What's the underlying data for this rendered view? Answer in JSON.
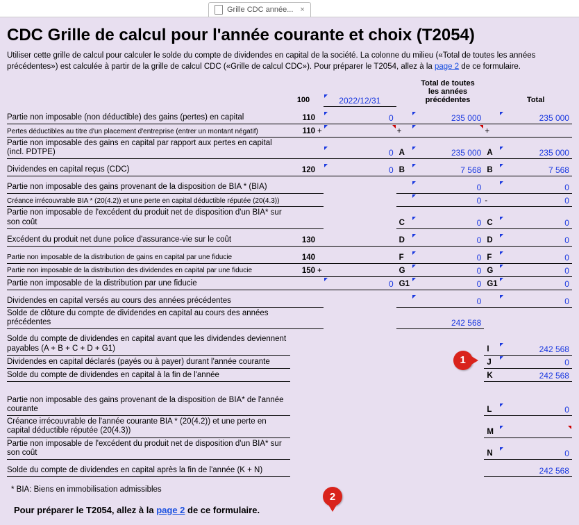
{
  "tab": {
    "label": "Grille CDC année..."
  },
  "title": "CDC Grille de calcul pour l'année courante et choix (T2054)",
  "intro_prefix": "Utiliser cette grille de calcul pour calculer le solde du compte de dividendes en capital de la société. La colonne du milieu («Total de toutes les années précédentes») est calculée à partir de la grille de calcul CDC («Grille de calcul CDC»). Pour préparer le T2054, allez à la ",
  "intro_link": "page 2",
  "intro_suffix": " de ce formulaire.",
  "col_header_100": "100",
  "date_value": "2022/12/31",
  "col_header_prev": "Total de toutes\nles années\nprécédentes",
  "col_header_total": "Total",
  "rows": {
    "r1": {
      "label": "Partie non imposable (non déductible) des gains (pertes) en capital",
      "line": "110",
      "cur": "0",
      "prev": "235 000",
      "tot": "235 000",
      "opcur": "",
      "opprev": "",
      "optot": ""
    },
    "r2": {
      "label": "Pertes déductibles au titre d'un placement d'entreprise (entrer un montant négatif)",
      "line": "110",
      "opcur": "+",
      "opprev": "+",
      "optot": "+"
    },
    "r3": {
      "label": "Partie non imposable des gains en capital par rapport aux pertes en capital (incl. PDTPE)",
      "cur": "0",
      "prev": "235 000",
      "tot": "235 000",
      "letA": "A"
    },
    "r4": {
      "label": "Dividendes en capital reçus (CDC)",
      "line": "120",
      "cur": "0",
      "prev": "7 568",
      "tot": "7 568",
      "letB": "B"
    },
    "r5": {
      "label": "Partie non imposable des gains provenant de la disposition de BIA * (BIA)",
      "prev": "0",
      "tot": "0"
    },
    "r6": {
      "label": "Créance irrécouvrable BIA * (20(4.2)) et une perte en capital déductible réputée (20(4.3))",
      "prev": "0",
      "tot": "0",
      "optot": "-"
    },
    "r7": {
      "label": "Partie non imposable de l'excédent du produit net de disposition d'un BIA* sur son coût",
      "prev": "0",
      "tot": "0",
      "letC": "C"
    },
    "r8": {
      "label": "Excédent du produit net dune police d'assurance-vie sur le coût",
      "line": "130",
      "prev": "0",
      "tot": "0",
      "letD": "D"
    },
    "r9": {
      "label": "Partie non imposable de la distribution de gains en capital par une fiducie",
      "line": "140",
      "prev": "0",
      "tot": "0",
      "letF": "F"
    },
    "r10": {
      "label": "Partie non imposable de la distribution des dividendes en capital par une fiducie",
      "line": "150",
      "opcur": "+",
      "opprev": "+",
      "optot": "+",
      "prev": "0",
      "tot": "0",
      "letG": "G"
    },
    "r11": {
      "label": "Partie non imposable de la distribution par une fiducie",
      "cur": "0",
      "prev": "0",
      "tot": "0",
      "letG1": "G1"
    },
    "r12": {
      "label": "Dividendes en capital versés au cours des années précédentes",
      "prev": "0",
      "tot": "0"
    },
    "r13": {
      "label": "Solde de clôture du compte de dividendes en capital au cours des années précédentes",
      "prev": "242 568"
    },
    "r14": {
      "label": "Solde du compte de dividendes en capital avant que les dividendes deviennent payables (A + B + C + D + G1)",
      "tot": "242 568",
      "letI": "I"
    },
    "r15": {
      "label": "Dividendes en capital déclarés (payés ou à payer) durant l'année courante",
      "tot": "0",
      "letJ": "J"
    },
    "r16": {
      "label": "Solde du compte de dividendes en capital à la fin de l'année",
      "tot": "242 568",
      "letK": "K"
    },
    "r17": {
      "label": "Partie non imposable des gains provenant de la disposition de BIA* de l'année courante",
      "tot": "0",
      "letL": "L"
    },
    "r18": {
      "label": "Créance irrécouvrable de l'année courante BIA * (20(4.2)) et une perte en capital déductible réputée (20(4.3))",
      "letM": "M",
      "optot": "-"
    },
    "r19": {
      "label": "Partie non imposable de l'excédent du produit net de disposition d'un BIA* sur son coût",
      "tot": "0",
      "letN": "N"
    },
    "r20": {
      "label": "Solde du compte de dividendes en capital après la fin de l'année (K + N)",
      "tot": "242 568"
    }
  },
  "footnote": "* BIA: Biens en immobilisation admissibles",
  "bottom_prefix": "Pour préparer le T2054, allez à la ",
  "bottom_link": "page 2",
  "bottom_suffix": " de ce formulaire.",
  "callout1": "1",
  "callout2": "2"
}
